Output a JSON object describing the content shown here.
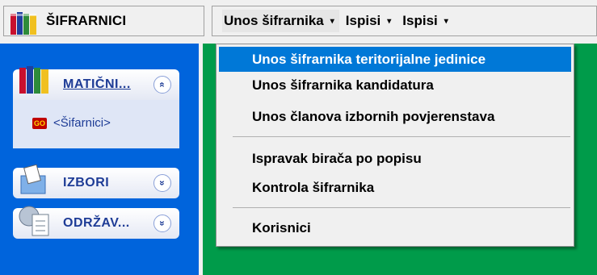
{
  "app": {
    "title": "ŠIFRARNICI"
  },
  "menubar": {
    "items": [
      {
        "label": "Unos šifrarnika",
        "arrow": "▾"
      },
      {
        "label": "Ispisi",
        "arrow": "▾"
      },
      {
        "label": "Ispisi",
        "arrow": "▾"
      }
    ]
  },
  "dropdown": {
    "items": [
      "Unos šifrarnika teritorijalne jedinice",
      "Unos šifrarnika kandidatura",
      "Unos članova izbornih povjerenstava",
      "Ispravak birača po popisu",
      "Kontrola šifrarnika",
      "Korisnici"
    ],
    "selected_index": 0
  },
  "sidebar": {
    "panels": [
      {
        "label": "MATIČNI...",
        "chevron": "«",
        "expanded": true
      },
      {
        "label": "IZBORI",
        "chevron": "»",
        "expanded": false
      },
      {
        "label": "ODRŽAV...",
        "chevron": "»",
        "expanded": false
      }
    ],
    "expanded_panel": {
      "link_label": "<Šifarnici>",
      "icon_text": "GO"
    }
  },
  "colors": {
    "sidebar_bg": "#0064dc",
    "content_bg": "#009b4a",
    "selection": "#0078d7"
  }
}
